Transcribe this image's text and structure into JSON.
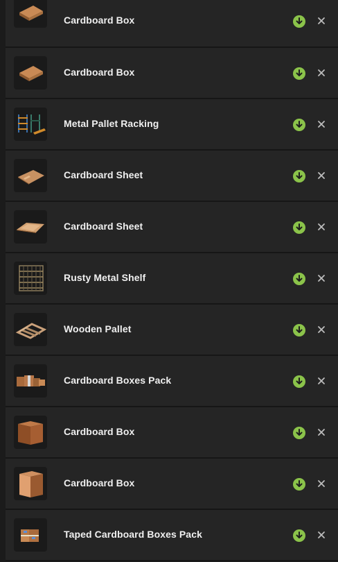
{
  "accent_color": "#8bc34a",
  "items": [
    {
      "name": "Cardboard Box",
      "thumb": "flat-box"
    },
    {
      "name": "Cardboard Box",
      "thumb": "flat-box"
    },
    {
      "name": "Metal Pallet Racking",
      "thumb": "racking"
    },
    {
      "name": "Cardboard Sheet",
      "thumb": "sheet"
    },
    {
      "name": "Cardboard Sheet",
      "thumb": "sheet"
    },
    {
      "name": "Rusty Metal Shelf",
      "thumb": "shelf"
    },
    {
      "name": "Wooden Pallet",
      "thumb": "pallet"
    },
    {
      "name": "Cardboard Boxes Pack",
      "thumb": "boxes-pack"
    },
    {
      "name": "Cardboard Box",
      "thumb": "cube-box"
    },
    {
      "name": "Cardboard Box",
      "thumb": "cube-box"
    },
    {
      "name": "Taped Cardboard Boxes Pack",
      "thumb": "taped-pack"
    }
  ]
}
